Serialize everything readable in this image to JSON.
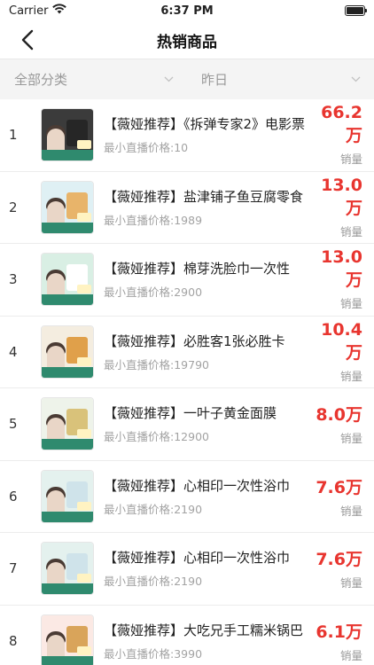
{
  "status": {
    "carrier": "Carrier",
    "time": "6:37 PM"
  },
  "nav": {
    "title": "热销商品"
  },
  "filters": {
    "category": "全部分类",
    "date": "昨日"
  },
  "items": [
    {
      "rank": "1",
      "title": "【薇娅推荐】《拆弹专家2》电影票",
      "price_label": "最小直播价格:10",
      "sales": "66.2万",
      "sales_label": "销量",
      "thumb_color": "#3b3b3b",
      "product_color": "#262626"
    },
    {
      "rank": "2",
      "title": "【薇娅推荐】盐津铺子鱼豆腐零食",
      "price_label": "最小直播价格:1989",
      "sales": "13.0万",
      "sales_label": "销量",
      "thumb_color": "#dff0f4",
      "product_color": "#e8b46a"
    },
    {
      "rank": "3",
      "title": "【薇娅推荐】棉芽洗脸巾一次性",
      "price_label": "最小直播价格:2900",
      "sales": "13.0万",
      "sales_label": "销量",
      "thumb_color": "#d9efe4",
      "product_color": "#ffffff"
    },
    {
      "rank": "4",
      "title": "【薇娅推荐】必胜客1张必胜卡",
      "price_label": "最小直播价格:19790",
      "sales": "10.4万",
      "sales_label": "销量",
      "thumb_color": "#f4ede0",
      "product_color": "#e0a04a"
    },
    {
      "rank": "5",
      "title": "【薇娅推荐】一叶子黄金面膜",
      "price_label": "最小直播价格:12900",
      "sales": "8.0万",
      "sales_label": "销量",
      "thumb_color": "#eef3ea",
      "product_color": "#d9c27a"
    },
    {
      "rank": "6",
      "title": "【薇娅推荐】心相印一次性浴巾",
      "price_label": "最小直播价格:2190",
      "sales": "7.6万",
      "sales_label": "销量",
      "thumb_color": "#e4f1ee",
      "product_color": "#cfe3ea"
    },
    {
      "rank": "7",
      "title": "【薇娅推荐】心相印一次性浴巾",
      "price_label": "最小直播价格:2190",
      "sales": "7.6万",
      "sales_label": "销量",
      "thumb_color": "#e4f1ee",
      "product_color": "#cfe3ea"
    },
    {
      "rank": "8",
      "title": "【薇娅推荐】大吃兄手工糯米锅巴",
      "price_label": "最小直播价格:3990",
      "sales": "6.1万",
      "sales_label": "销量",
      "thumb_color": "#fbe9e4",
      "product_color": "#d9a45a"
    }
  ]
}
